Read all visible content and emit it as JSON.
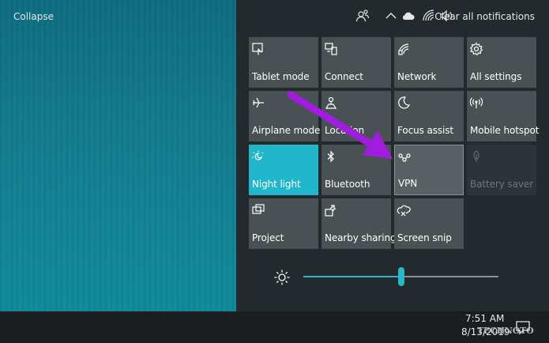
{
  "action_center": {
    "collapse_label": "Collapse",
    "clear_all_label": "Clear all notifications",
    "tiles": [
      {
        "label": "Tablet mode",
        "icon": "tablet-mode-icon",
        "state": "off"
      },
      {
        "label": "Connect",
        "icon": "connect-icon",
        "state": "off"
      },
      {
        "label": "Network",
        "icon": "network-icon",
        "state": "off"
      },
      {
        "label": "All settings",
        "icon": "gear-icon",
        "state": "off"
      },
      {
        "label": "Airplane mode",
        "icon": "airplane-icon",
        "state": "off"
      },
      {
        "label": "Location",
        "icon": "location-icon",
        "state": "off"
      },
      {
        "label": "Focus assist",
        "icon": "moon-icon",
        "state": "off"
      },
      {
        "label": "Mobile hotspot",
        "icon": "hotspot-icon",
        "state": "off"
      },
      {
        "label": "Night light",
        "icon": "night-light-icon",
        "state": "on"
      },
      {
        "label": "Bluetooth",
        "icon": "bluetooth-icon",
        "state": "off"
      },
      {
        "label": "VPN",
        "icon": "vpn-icon",
        "state": "highlighted"
      },
      {
        "label": "Battery saver",
        "icon": "battery-saver-icon",
        "state": "disabled"
      },
      {
        "label": "Project",
        "icon": "project-icon",
        "state": "off"
      },
      {
        "label": "Nearby sharing",
        "icon": "nearby-sharing-icon",
        "state": "off"
      },
      {
        "label": "Screen snip",
        "icon": "screen-snip-icon",
        "state": "off"
      }
    ],
    "brightness_fraction": 0.5,
    "accent_color": "#21b6c9",
    "arrow_color": "#a21ce0"
  },
  "taskbar": {
    "time": "7:51 AM",
    "date": "8/13/2019",
    "watermark": "TECHNOTO"
  }
}
